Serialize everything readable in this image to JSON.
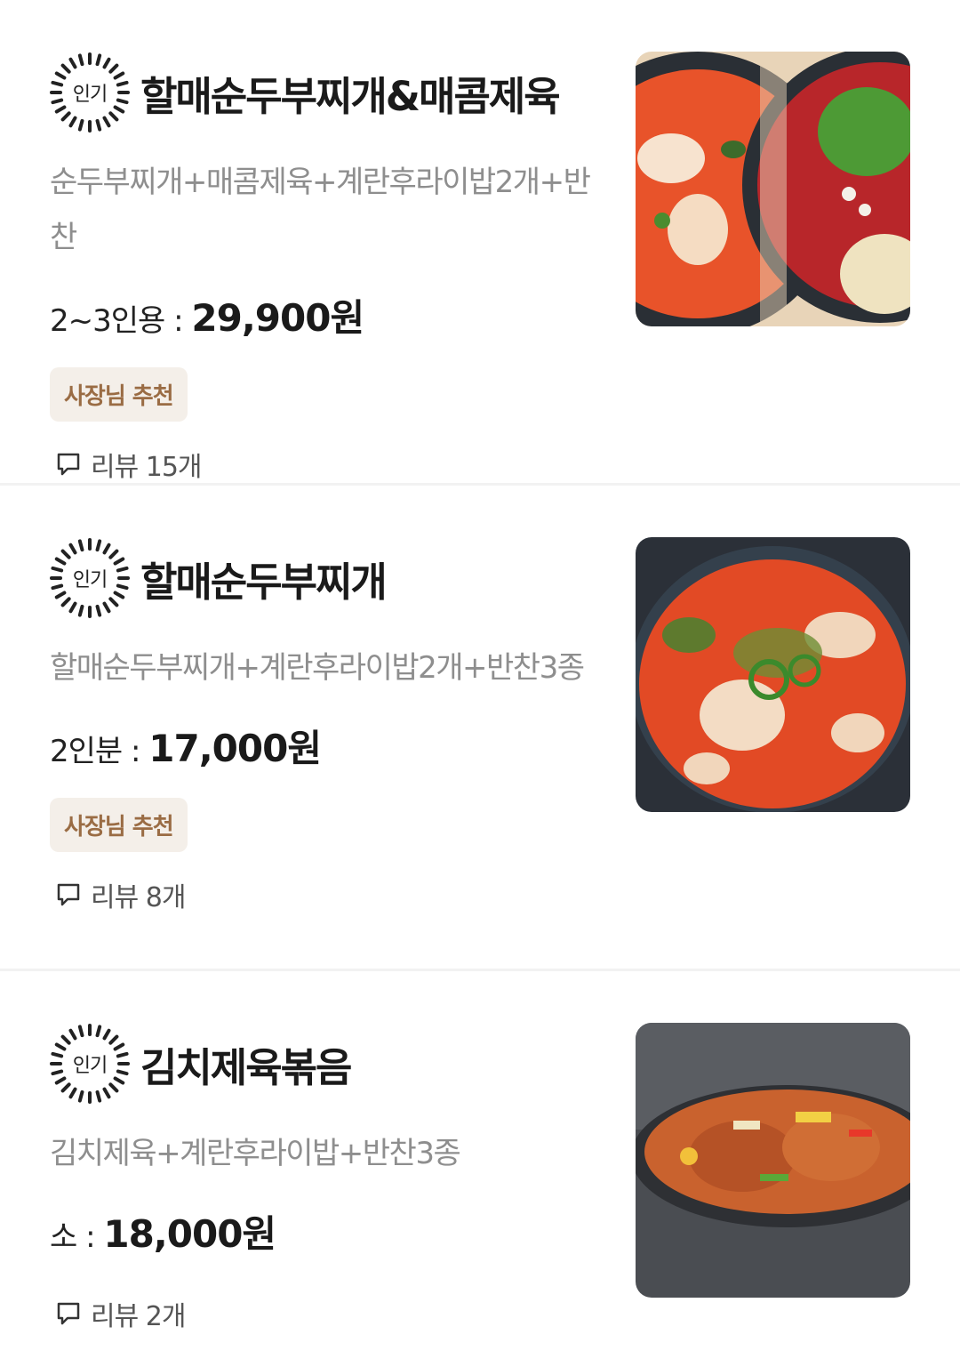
{
  "menu_items": [
    {
      "badge": "인기",
      "title": "할매순두부찌개&매콤제육",
      "description": "순두부찌개+매콤제육+계란후라이밥2개+반찬",
      "size": "2~3인용 : ",
      "price": "29,900원",
      "tag": "사장님 추천",
      "reviews": "리뷰 15개"
    },
    {
      "badge": "인기",
      "title": "할매순두부찌개",
      "description": "할매순두부찌개+계란후라이밥2개+반찬3종",
      "size": "2인분 : ",
      "price": "17,000원",
      "tag": "사장님 추천",
      "reviews": "리뷰 8개"
    },
    {
      "badge": "인기",
      "title": "김치제육볶음",
      "description": "김치제육+계란후라이밥+반찬3종",
      "size": "소 : ",
      "price": "18,000원",
      "reviews": "리뷰 2개"
    }
  ],
  "colors": {
    "tag_bg": "#f4efe9",
    "tag_text": "#9a6c44",
    "desc_text": "#8e8e8e"
  },
  "icons": {
    "badge": "popular-burst-icon",
    "reviews": "speech-bubble-icon"
  }
}
